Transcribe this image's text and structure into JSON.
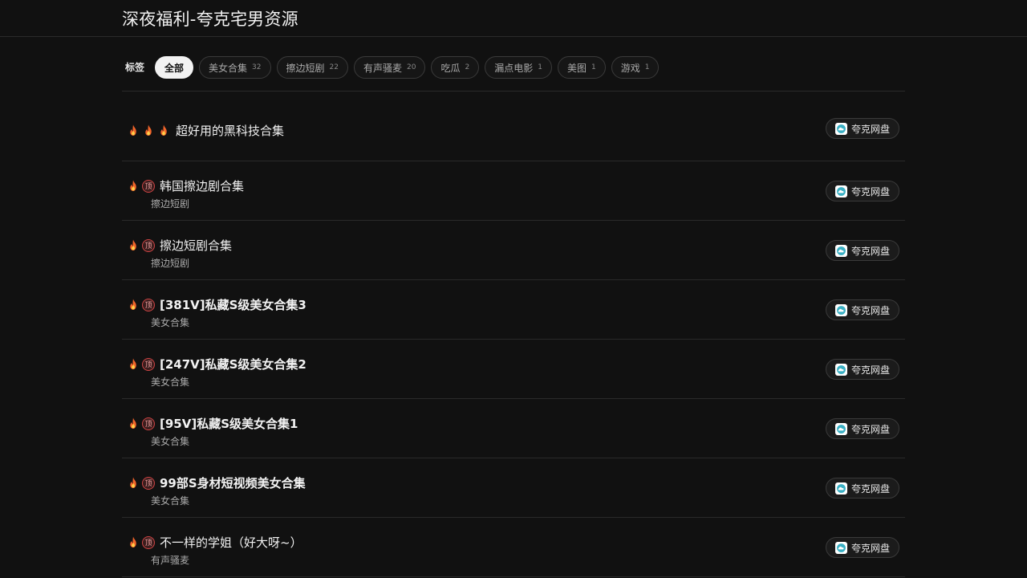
{
  "site": {
    "title": "深夜福利-夸克宅男资源"
  },
  "tags": {
    "label": "标签",
    "items": [
      {
        "label": "全部",
        "count": "",
        "active": true
      },
      {
        "label": "美女合集",
        "count": "32"
      },
      {
        "label": "擦边短剧",
        "count": "22"
      },
      {
        "label": "有声骚麦",
        "count": "20"
      },
      {
        "label": "吃瓜",
        "count": "2"
      },
      {
        "label": "漏点电影",
        "count": "1"
      },
      {
        "label": "美图",
        "count": "1"
      },
      {
        "label": "游戏",
        "count": "1"
      }
    ]
  },
  "list": {
    "button_label": "夸克网盘",
    "items": [
      {
        "title": "超好用的黑科技合集",
        "category": "",
        "badges": [
          "fire",
          "fire",
          "fire"
        ],
        "bold": false
      },
      {
        "title": "韩国擦边剧合集",
        "category": "擦边短剧",
        "badges": [
          "fire",
          "pin"
        ],
        "bold": false
      },
      {
        "title": "擦边短剧合集",
        "category": "擦边短剧",
        "badges": [
          "fire",
          "pin"
        ],
        "bold": false
      },
      {
        "title": "[381V]私藏S级美女合集3",
        "category": "美女合集",
        "badges": [
          "fire",
          "pin"
        ],
        "bold": true
      },
      {
        "title": "[247V]私藏S级美女合集2",
        "category": "美女合集",
        "badges": [
          "fire",
          "pin"
        ],
        "bold": true
      },
      {
        "title": "[95V]私藏S级美女合集1",
        "category": "美女合集",
        "badges": [
          "fire",
          "pin"
        ],
        "bold": true
      },
      {
        "title": "99部S身材短视频美女合集",
        "category": "美女合集",
        "badges": [
          "fire",
          "pin"
        ],
        "bold": true
      },
      {
        "title": "不一样的学姐（好大呀~）",
        "category": "有声骚麦",
        "badges": [
          "fire",
          "pin"
        ],
        "bold": false
      }
    ]
  },
  "icons": {
    "fire": "fire-icon",
    "pin": "pinned-icon",
    "cloud": "quark-cloud-icon"
  },
  "colors": {
    "background": "#111111",
    "text": "#eaeaea",
    "muted": "#a9a9a9",
    "border": "#2a2a2a",
    "active_tag_bg": "#f2f2f2"
  }
}
